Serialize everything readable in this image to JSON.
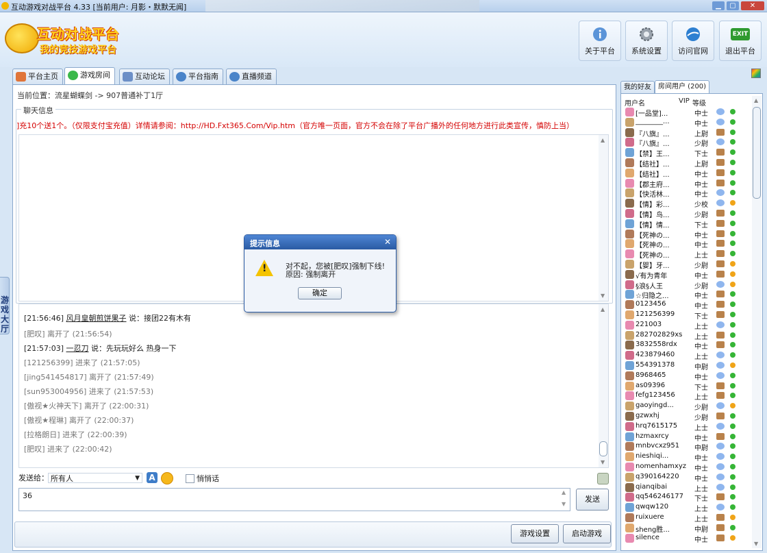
{
  "window": {
    "title": "互动游戏对战平台 4.33 [当前用户: 月影・默默无闻]"
  },
  "brand": {
    "logo_title": "互动对战平台",
    "logo_subtitle": "我的竞技游戏平台"
  },
  "toolbar": {
    "about": "关于平台",
    "settings": "系统设置",
    "website": "访问官网",
    "exit": "退出平台",
    "exit_icon_text": "EXIT"
  },
  "tabs": [
    {
      "label": "平台主页"
    },
    {
      "label": "游戏房间"
    },
    {
      "label": "互动论坛"
    },
    {
      "label": "平台指南"
    },
    {
      "label": "直播频道"
    }
  ],
  "side_tab": "游戏大厅",
  "breadcrumb": "当前位置：流星蝴蝶剑 -> 907普通补丁1厅",
  "chat": {
    "legend": "聊天信息",
    "notice": "]充10个送1个。（仅限支付宝充值）详情请参阅：http://HD.Fxt365.Com/Vip.htm（官方唯一页面，官方不会在除了平台广播外的任何地方进行此类宣传，慎防上当）",
    "messages": [
      {
        "time": "[21:56:46]",
        "user": "风月皇朝煎饼果子",
        "text": "说：接团22有木有"
      },
      {
        "text": "[肥叹] 离开了 (21:56:54)"
      },
      {
        "time": "[21:57:03]",
        "user": "一忍刀",
        "text": "说：先玩玩好么  热身一下"
      },
      {
        "text": "[121256399] 进来了 (21:57:05)"
      },
      {
        "text": "[jing541454817] 离开了 (21:57:49)"
      },
      {
        "text": "[sun953004956] 进来了 (21:57:53)"
      },
      {
        "text": "[傲视★火神天下] 离开了 (22:00:31)"
      },
      {
        "text": "[傲视★程琳] 离开了 (22:00:37)"
      },
      {
        "text": "[拉格朗日] 进来了 (22:00:39)"
      },
      {
        "text": "[肥叹] 进来了 (22:00:42)"
      }
    ]
  },
  "send": {
    "label": "发送给：",
    "target": "所有人",
    "whisper": "悄悄话",
    "input_value": "36",
    "send_button": "发送"
  },
  "bottom": {
    "game_settings": "游戏设置",
    "start_game": "启动游戏"
  },
  "right_panel": {
    "tab_friends": "我的好友",
    "tab_room_users": "房间用户 (200)",
    "col_username": "用户名",
    "col_vip": "VIP",
    "col_level": "等级",
    "users": [
      {
        "name": "[一品堂]...",
        "rank": "中士",
        "vip": "chat",
        "status": "green"
      },
      {
        "name": "________...",
        "rank": "中士",
        "vip": "chat",
        "status": "green"
      },
      {
        "name": "『八旗』...",
        "rank": "上尉",
        "vip": "mail",
        "status": "green"
      },
      {
        "name": "『八旗』...",
        "rank": "少尉",
        "vip": "chat",
        "status": "green"
      },
      {
        "name": "【禁】王...",
        "rank": "下士",
        "vip": "mail",
        "status": "green"
      },
      {
        "name": "【结社】...",
        "rank": "上尉",
        "vip": "mail",
        "status": "green"
      },
      {
        "name": "【结社】...",
        "rank": "中士",
        "vip": "mail",
        "status": "green"
      },
      {
        "name": "【郡主府...",
        "rank": "中士",
        "vip": "mail",
        "status": "green"
      },
      {
        "name": "【快活林...",
        "rank": "中士",
        "vip": "chat",
        "status": "green"
      },
      {
        "name": "【情】彩...",
        "rank": "少校",
        "vip": "chat",
        "status": "orange"
      },
      {
        "name": "【情】鸟...",
        "rank": "少尉",
        "vip": "mail",
        "status": "green"
      },
      {
        "name": "【情】情...",
        "rank": "下士",
        "vip": "mail",
        "status": "green"
      },
      {
        "name": "【死神の...",
        "rank": "中士",
        "vip": "mail",
        "status": "green"
      },
      {
        "name": "【死神の...",
        "rank": "中士",
        "vip": "mail",
        "status": "green"
      },
      {
        "name": "【死神の...",
        "rank": "上士",
        "vip": "mail",
        "status": "green"
      },
      {
        "name": "【婴】牙...",
        "rank": "少尉",
        "vip": "mail",
        "status": "orange"
      },
      {
        "name": "√有为青年",
        "rank": "中士",
        "vip": "mail",
        "status": "orange"
      },
      {
        "name": "§浪§人王",
        "rank": "少尉",
        "vip": "chat",
        "status": "orange"
      },
      {
        "name": "☆归隐之...",
        "rank": "中士",
        "vip": "mail",
        "status": "green"
      },
      {
        "name": "0123456",
        "rank": "中士",
        "vip": "mail",
        "status": "green"
      },
      {
        "name": "121256399",
        "rank": "下士",
        "vip": "mail",
        "status": "green"
      },
      {
        "name": "221003",
        "rank": "上士",
        "vip": "chat",
        "status": "green"
      },
      {
        "name": "282702829xs",
        "rank": "上士",
        "vip": "mail",
        "status": "green"
      },
      {
        "name": "3832558rdx",
        "rank": "中士",
        "vip": "mail",
        "status": "green"
      },
      {
        "name": "423879460",
        "rank": "上士",
        "vip": "chat",
        "status": "green"
      },
      {
        "name": "554391378",
        "rank": "中尉",
        "vip": "chat",
        "status": "orange"
      },
      {
        "name": "8968465",
        "rank": "中士",
        "vip": "chat",
        "status": "green"
      },
      {
        "name": "as09396",
        "rank": "下士",
        "vip": "mail",
        "status": "green"
      },
      {
        "name": "fefg123456",
        "rank": "上士",
        "vip": "mail",
        "status": "green"
      },
      {
        "name": "gaoyingd...",
        "rank": "少尉",
        "vip": "chat",
        "status": "orange"
      },
      {
        "name": "gzwxhj",
        "rank": "少尉",
        "vip": "mail",
        "status": "green"
      },
      {
        "name": "hrq7615175",
        "rank": "上士",
        "vip": "chat",
        "status": "green"
      },
      {
        "name": "hzmaxrcy",
        "rank": "中士",
        "vip": "mail",
        "status": "green"
      },
      {
        "name": "mnbvcxz951",
        "rank": "中尉",
        "vip": "chat",
        "status": "green"
      },
      {
        "name": "nieshiqi...",
        "rank": "中士",
        "vip": "chat",
        "status": "green"
      },
      {
        "name": "nomenhamxyz",
        "rank": "中士",
        "vip": "chat",
        "status": "green"
      },
      {
        "name": "q390164220",
        "rank": "中士",
        "vip": "chat",
        "status": "green"
      },
      {
        "name": "qianqibai",
        "rank": "上士",
        "vip": "chat",
        "status": "green"
      },
      {
        "name": "qq546246177",
        "rank": "下士",
        "vip": "mail",
        "status": "green"
      },
      {
        "name": "qwqw120",
        "rank": "上士",
        "vip": "chat",
        "status": "green"
      },
      {
        "name": "ruixuere",
        "rank": "上士",
        "vip": "mail",
        "status": "orange"
      },
      {
        "name": "sheng胜...",
        "rank": "中尉",
        "vip": "mail",
        "status": "green"
      },
      {
        "name": "silence",
        "rank": "中士",
        "vip": "mail",
        "status": "orange"
      }
    ]
  },
  "dialog": {
    "title": "提示信息",
    "line1": "对不起，您被[肥叹]强制下线!",
    "line2": "原因: 强制离开",
    "ok": "确定"
  },
  "colors": {
    "accent": "#2a5aa3",
    "notice": "#d40000",
    "panel_bg": "#d7e6f5"
  }
}
